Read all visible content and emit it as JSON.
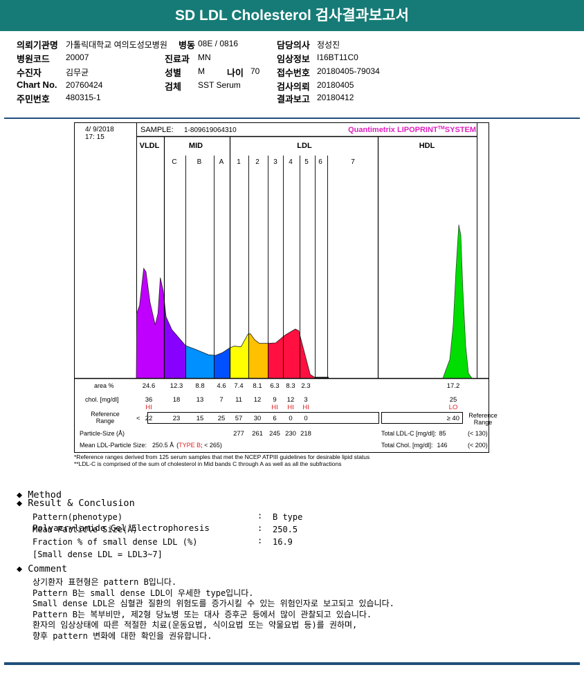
{
  "title": "SD LDL Cholesterol 검사결과보고서",
  "info": [
    {
      "label": "의뢰기관명",
      "value": "가톨릭대학교 여의도성모병원"
    },
    {
      "label": "병동",
      "value": "08E / 0816"
    },
    {
      "label": "담당의사",
      "value": "정성진"
    },
    {
      "label": "병원코드",
      "value": "20007"
    },
    {
      "label": "진료과",
      "value": "MN"
    },
    {
      "label": "임상정보",
      "value": "I16BT11C0"
    },
    {
      "label": "수진자",
      "value": "김무균"
    },
    {
      "label": "성별",
      "value": "M"
    },
    {
      "label": "나이",
      "value": "70"
    },
    {
      "label": "접수번호",
      "value": "20180405-79034"
    },
    {
      "label": "Chart No.",
      "value": "20760424"
    },
    {
      "label": "검체",
      "value": "SST Serum"
    },
    {
      "label": "검사의뢰",
      "value": "20180405"
    },
    {
      "label": "주민번호",
      "value": "480315-1"
    },
    {
      "label": "결과보고",
      "value": "20180412"
    }
  ],
  "report": {
    "date": "4/ 9/2018",
    "time": "17: 15",
    "sample_label": "SAMPLE:",
    "sample_id": "1-809619064310",
    "system": "Quantimetrix LIPOPRINT",
    "system_tm": "TM",
    "system_suffix": "SYSTEM",
    "groups": [
      "VLDL",
      "MID",
      "LDL",
      "HDL"
    ],
    "bands": [
      "C",
      "B",
      "A",
      "1",
      "2",
      "3",
      "4",
      "5",
      "6",
      "7"
    ],
    "row_labels": {
      "area": "area %",
      "chol": "chol. [mg/dl]",
      "ref": "Reference",
      "ref2": "Range",
      "psize": "Particle-Size (Å)",
      "mean": "Mean LDL-Particle Size:"
    },
    "area": [
      "24.6",
      "12.3",
      "8.8",
      "4.6",
      "7.4",
      "8.1",
      "6.3",
      "8.3",
      "2.3"
    ],
    "area_hdl": "17.2",
    "chol": [
      "36",
      "18",
      "13",
      "7",
      "11",
      "12",
      "9",
      "12",
      "3"
    ],
    "chol_flags": [
      "HI",
      "",
      "",
      "",
      "",
      "",
      "HI",
      "HI",
      "HI"
    ],
    "chol_hdl": "25",
    "chol_hdl_flag": "LO",
    "ref_prefix": "<",
    "ref": [
      "22",
      "23",
      "15",
      "25",
      "57",
      "30",
      "6",
      "0",
      "0"
    ],
    "ref_hdl": "≥ 40",
    "particle_size": [
      "277",
      "261",
      "245",
      "230",
      "218"
    ],
    "mean_size": "250.5 Å",
    "mean_type": "TYPE B",
    "mean_ref": "; < 265)",
    "mean_open": "(",
    "total_ldl_label": "Total LDL-C [mg/dl]:",
    "total_ldl": "85",
    "total_ldl_ref": "(< 130)",
    "total_chol_label": "Total Chol. [mg/dl]:",
    "total_chol": "146",
    "total_chol_ref": "(< 200)",
    "footnote1": "*Reference ranges derived from 125 serum samples that met the NCEP ATPIII guidelines for desirable lipid status",
    "footnote2": "**LDL-C is comprised of the sum of cholesterol in Mid bands C through A as well as all the subfractions",
    "colors": {
      "vldl": "#c000ff",
      "c": "#8800ff",
      "b": "#0090ff",
      "a": "#0050ff",
      "l1": "#ffff00",
      "l2": "#ffc000",
      "l3": "#ff1040",
      "hdl": "#00dd00",
      "flag": "#e02020",
      "brand": "#e020c0"
    }
  },
  "method": {
    "heading": "Method",
    "text": "Polyacrylamide Gel Electrophoresis"
  },
  "result": {
    "heading": "Result & Conclusion",
    "rows": [
      {
        "label": "Pattern(phenotype)",
        "value": "B type"
      },
      {
        "label": "Mean Particle Size(Å)",
        "value": "250.5"
      },
      {
        "label": "Fraction % of small dense LDL (%)",
        "value": "16.9"
      }
    ],
    "note": "[Small dense LDL = LDL3~7]"
  },
  "comment": {
    "heading": "Comment",
    "lines": [
      "상기환자 표현형은 pattern B입니다.",
      "Pattern B는 small dense LDL이 우세한 type입니다.",
      "Small dense LDL은 심혈관 질환의 위험도를 증가시킬 수 있는 위험인자로 보고되고 있습니다.",
      "Pattern B는 복부비만, 제2형 당뇨병 또는 대사 증후군 등에서 많이 관찰되고 있습니다.",
      "환자의 임상상태에 따른 적절한 치료(운동요법, 식이요법 또는 약물요법 등)를 권하며,",
      "향후 pattern 변화에 대한 확인을 권유합니다."
    ]
  }
}
